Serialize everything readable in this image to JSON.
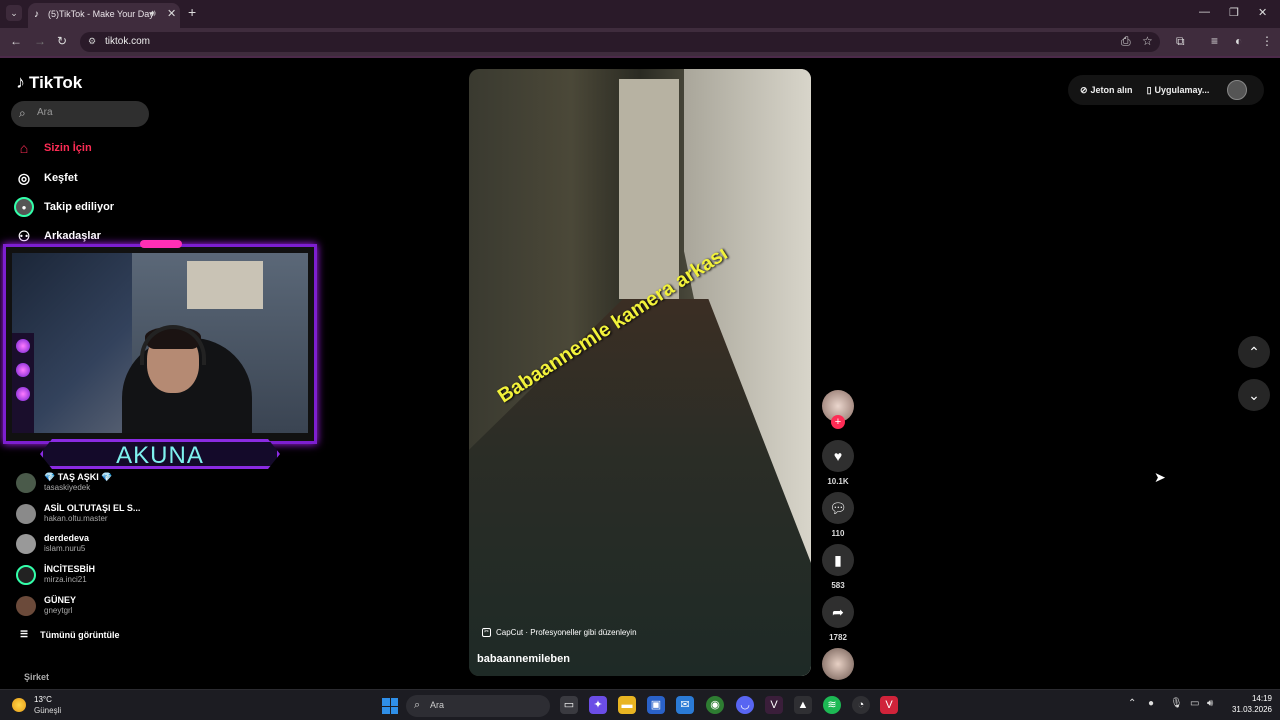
{
  "browser": {
    "tab_title": "(5)TikTok - Make Your Day",
    "url": "tiktok.com"
  },
  "sidebar": {
    "logo": "TikTok",
    "search_placeholder": "Ara",
    "nav": [
      {
        "label": "Sizin İçin",
        "icon": "home-icon",
        "active": true
      },
      {
        "label": "Keşfet",
        "icon": "compass-icon"
      },
      {
        "label": "Takip ediliyor",
        "icon": "avatar-icon"
      },
      {
        "label": "Arkadaşlar",
        "icon": "friends-icon"
      }
    ],
    "following": [
      {
        "name": "💎 TAŞ AŞKI 💎",
        "user": "tasaskiyedek"
      },
      {
        "name": "ASİL OLTUTAŞI EL S...",
        "user": "hakan.oltu.master"
      },
      {
        "name": "derdedeva",
        "user": "islam.nuru5"
      },
      {
        "name": "İNCİTESBİH",
        "user": "mirza.inci21"
      },
      {
        "name": "GÜNEY",
        "user": "gneytgrl"
      }
    ],
    "see_all": "Tümünü görüntüle",
    "company": "Şirket"
  },
  "overlay": {
    "streamer_name": "AKUNA"
  },
  "video": {
    "caption": "Babaannemle kamera arkası",
    "capcut": "CapCut · Profesyoneller gibi düzenleyin",
    "author": "babaannemileben",
    "likes": "10.1K",
    "comments": "110",
    "saves": "583",
    "shares": "1782"
  },
  "topbar": {
    "coins": "Jeton alın",
    "app": "Uygulamay..."
  },
  "taskbar": {
    "temp": "13°C",
    "weather": "Güneşli",
    "search": "Ara",
    "time": "14:19",
    "date": "31.03.2026"
  }
}
